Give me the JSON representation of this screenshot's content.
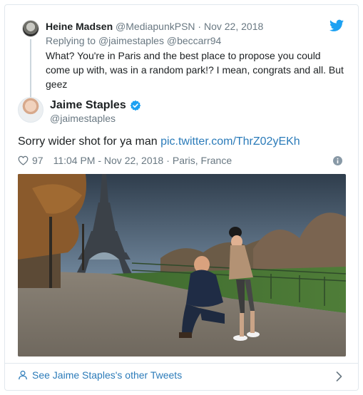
{
  "parent_tweet": {
    "name": "Heine Madsen",
    "handle": "@MediapunkPSN",
    "separator": "·",
    "date": "Nov 22, 2018",
    "replying_prefix": "Replying to",
    "replying_to_1": "@jaimestaples",
    "replying_to_2": "@beccarr94",
    "text": "What? You're in Paris and the best place to propose you could come up with, was in a random park!? I mean, congrats and all. But geez"
  },
  "main_tweet": {
    "name": "Jaime Staples",
    "handle": "@jaimestaples",
    "verified_icon": "verified-badge-icon",
    "text": "Sorry wider shot for ya man",
    "link": "pic.twitter.com/ThrZ02yEKh",
    "likes": "97",
    "time_date": "11:04 PM - Nov 22, 2018",
    "location_sep": "·",
    "location": "Paris, France"
  },
  "footer": {
    "see_more": "See Jaime Staples's other Tweets"
  },
  "icons": {
    "logo": "twitter-bird-icon",
    "like": "heart-icon",
    "info": "info-icon",
    "person": "person-icon",
    "chevron": "chevron-right-icon"
  },
  "colors": {
    "link": "#2b7bb9",
    "muted": "#697882",
    "twitter_blue": "#1da1f2",
    "border": "#e1e8ed"
  }
}
